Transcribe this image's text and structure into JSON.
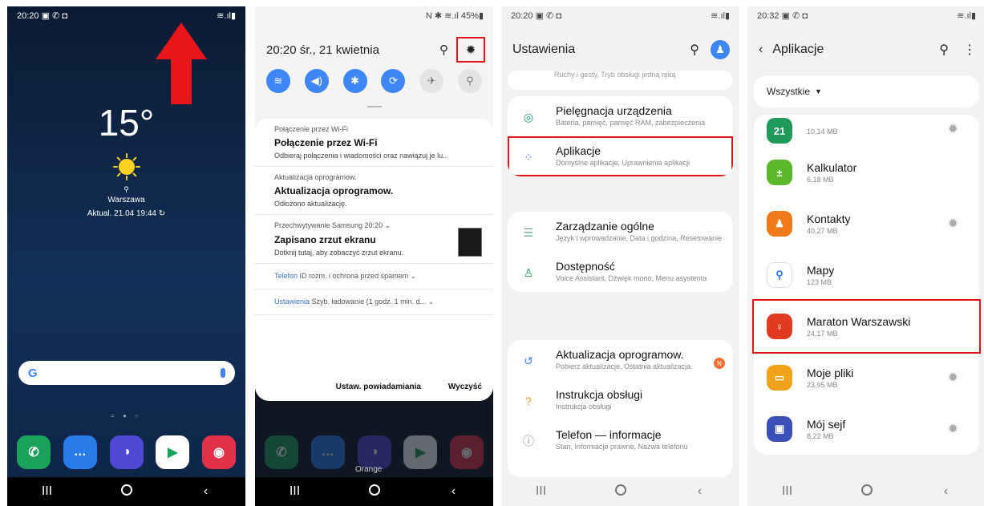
{
  "panel1": {
    "status_time": "20:20",
    "status_icons_left": "▣ ✆ ◘",
    "status_icons_right": "≋.ıl▮",
    "temperature": "15°",
    "city": "Warszawa",
    "updated": "Aktual. 21.04 19:44",
    "search_logo": "G",
    "dock": [
      {
        "name": "phone",
        "glyph": "✆",
        "color": "#1aa25a"
      },
      {
        "name": "messages",
        "glyph": "…",
        "color": "#2a7bea"
      },
      {
        "name": "internet",
        "glyph": "◑",
        "color": "#5148d6"
      },
      {
        "name": "play-store",
        "glyph": "▶",
        "color": "#ffffff"
      },
      {
        "name": "camera",
        "glyph": "◉",
        "color": "#e2324a"
      }
    ],
    "nav": {
      "recents": "III",
      "back": "‹"
    }
  },
  "panel2": {
    "status_right": "N ✱ ≋.ıl 45%▮",
    "date_time": "20:20  śr., 21 kwietnia",
    "toggles": [
      {
        "name": "wifi",
        "glyph": "≋",
        "on": true
      },
      {
        "name": "sound",
        "glyph": "◀)",
        "on": true
      },
      {
        "name": "bluetooth",
        "glyph": "✱",
        "on": true
      },
      {
        "name": "auto-rotate",
        "glyph": "⟳",
        "on": true
      },
      {
        "name": "airplane",
        "glyph": "✈",
        "on": false
      },
      {
        "name": "flashlight",
        "glyph": "⚲",
        "on": false
      }
    ],
    "notifications": [
      {
        "src": "Połączenie przez Wi-Fi",
        "title": "Połączenie przez Wi-Fi",
        "body": "Odbieraj połączenia i wiadomości oraz nawiązuj je lu.."
      },
      {
        "src": "Aktualizacja oprogramow.",
        "title": "Aktualizacja oprogramow.",
        "body": "Odłożono aktualizację."
      },
      {
        "src": "Przechwytywanie Samsung  20:20  ⌄",
        "title": "Zapisano zrzut ekranu",
        "body": "Dotknij tutaj, aby zobaczyć zrzut ekranu."
      }
    ],
    "slim": [
      {
        "app": "Telefon",
        "text": "ID rozm. i ochrona przed spamem  ⌄"
      },
      {
        "app": "Ustawienia",
        "text": "Szyb. ładowanie (1 godz. 1 min. d...  ⌄"
      }
    ],
    "action_settings": "Ustaw. powiadamiania",
    "action_clear": "Wyczyść",
    "bg_label": "Orange"
  },
  "panel3": {
    "status_time": "20:20",
    "status_icons_left": "▣ ✆ ◘",
    "status_icons_right": "≋.ıl▮",
    "title": "Ustawienia",
    "top_cut": "Ruchy i gesty, Tryb obsługi jedną ręką",
    "items": [
      {
        "name": "device-care",
        "title": "Pielęgnacja urządzenia",
        "sub": "Bateria, pamięć, pamięć RAM, zabezpieczenia",
        "glyph": "◎",
        "color": "#1f9a7a"
      },
      {
        "name": "apps",
        "title": "Aplikacje",
        "sub": "Domyślne aplikacje, Uprawnienia aplikacji",
        "glyph": "⁘",
        "color": "#3e86f5"
      },
      {
        "name": "general-management",
        "title": "Zarządzanie ogólne",
        "sub": "Język i wprowadzanie, Data i godzina, Resetowanie",
        "glyph": "☰",
        "color": "#7aa7a0"
      },
      {
        "name": "accessibility",
        "title": "Dostępność",
        "sub": "Voice Assistant, Dźwięk mono, Menu asystenta",
        "glyph": "♙",
        "color": "#1f9a5a"
      },
      {
        "name": "software-update",
        "title": "Aktualizacja oprogramow.",
        "sub": "Pobierz aktualizacje, Ostatnia aktualizacja",
        "glyph": "↺",
        "color": "#3e86f5",
        "badge": "N"
      },
      {
        "name": "user-manual",
        "title": "Instrukcja obsługi",
        "sub": "Instrukcja obsługi",
        "glyph": "?",
        "color": "#f2a11a"
      },
      {
        "name": "about-phone",
        "title": "Telefon — informacje",
        "sub": "Stan, Informacje prawne, Nazwa telefonu",
        "glyph": "ⓘ",
        "color": "#888888"
      }
    ]
  },
  "panel4": {
    "status_time": "20:32",
    "status_icons_left": "▣ ✆ ◘",
    "status_icons_right": "≋.ıl▮",
    "title": "Aplikacje",
    "filter": "Wszystkie",
    "apps": [
      {
        "name": "",
        "size": "10,14 MB",
        "glyph": "21",
        "color": "#1f9a5a",
        "gear": true
      },
      {
        "name": "Kalkulator",
        "size": "6,18 MB",
        "glyph": "±",
        "color": "#5ab82a",
        "gear": false
      },
      {
        "name": "Kontakty",
        "size": "40,27 MB",
        "glyph": "♟",
        "color": "#f07a1a",
        "gear": true
      },
      {
        "name": "Mapy",
        "size": "123 MB",
        "glyph": "⚲",
        "color": "#ffffff",
        "gear": false
      },
      {
        "name": "Maraton Warszawski",
        "size": "24,17 MB",
        "glyph": "♀",
        "color": "#e23a20",
        "gear": false
      },
      {
        "name": "Moje pliki",
        "size": "23,95 MB",
        "glyph": "▭",
        "color": "#f2a11a",
        "gear": true
      },
      {
        "name": "Mój sejf",
        "size": "8,22 MB",
        "glyph": "▣",
        "color": "#3a4fb8",
        "gear": true
      }
    ]
  }
}
